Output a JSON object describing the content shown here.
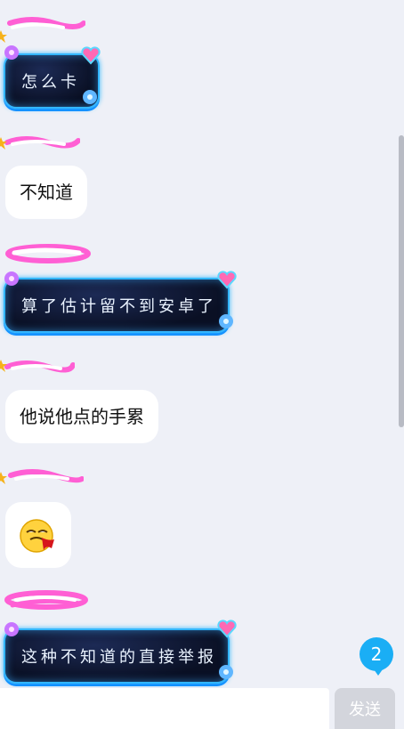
{
  "messages": [
    {
      "type": "dark",
      "text": "怎么卡"
    },
    {
      "type": "white",
      "text": "不知道"
    },
    {
      "type": "dark",
      "text": "算了估计留不到安卓了"
    },
    {
      "type": "white",
      "text": "他说他点的手累"
    },
    {
      "type": "emoji",
      "icon": "bleeding-face-emoji"
    },
    {
      "type": "dark",
      "text": "这种不知道的直接举报"
    }
  ],
  "badge": {
    "count": "2"
  },
  "input": {
    "placeholder": "",
    "send_label": "发送"
  },
  "colors": {
    "bubble_dark_border": "#33b6ff",
    "badge": "#1aaef5",
    "background": "#eef0f7"
  }
}
